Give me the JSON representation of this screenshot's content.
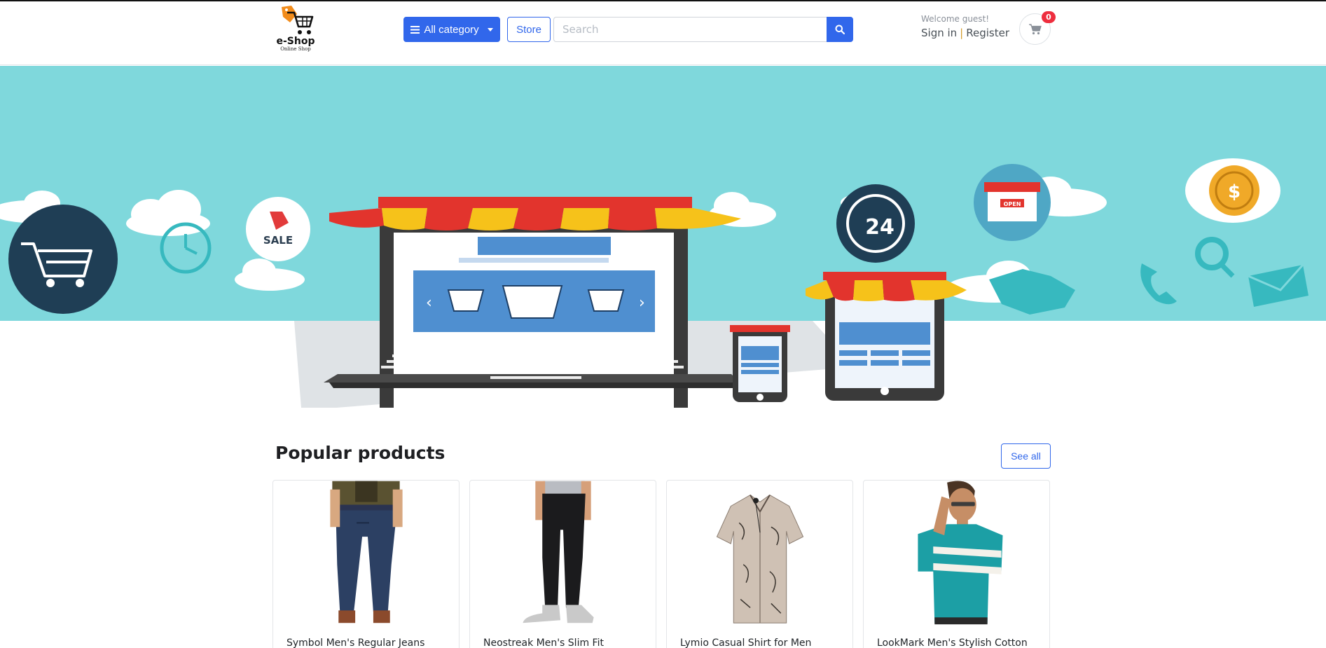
{
  "header": {
    "logo": {
      "name": "e-Shop",
      "tagline": "Online Shop"
    },
    "category_button": "All category",
    "store_button": "Store",
    "search": {
      "placeholder": "Search",
      "value": ""
    },
    "welcome": "Welcome guest!",
    "sign_in": "Sign in",
    "separator": "|",
    "register": "Register",
    "cart_count": "0"
  },
  "banner": {
    "sale_label": "SALE",
    "hours_label": "24",
    "open_label": "OPEN"
  },
  "popular": {
    "title": "Popular products",
    "see_all": "See all",
    "products": [
      {
        "title": "Symbol Men's Regular Jeans"
      },
      {
        "title": "Neostreak Men's Slim Fit"
      },
      {
        "title": "Lymio Casual Shirt for Men"
      },
      {
        "title": "LookMark Men's Stylish Cotton"
      }
    ]
  },
  "colors": {
    "primary": "#3167eb",
    "badge": "#ee2e3e",
    "banner_sky": "#7fd8dc"
  }
}
